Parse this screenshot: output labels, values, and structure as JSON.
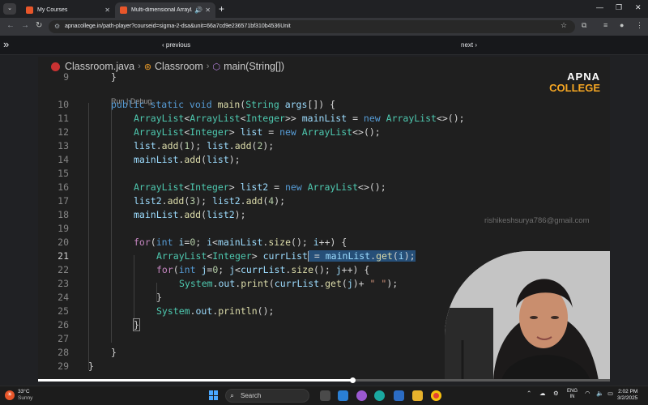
{
  "browser": {
    "tabs": [
      {
        "title": "My Courses",
        "active": false
      },
      {
        "title": "Multi-dimensional ArrayLi...",
        "active": true
      }
    ],
    "url": "apnacollege.in/path-player?courseid=sigma-2-dsa&unit=66a7cd9e236571bf310b4536Unit"
  },
  "player": {
    "prev_label": "‹ previous",
    "next_label": "next ›",
    "progress": 0.55
  },
  "editor": {
    "breadcrumb": {
      "file": "Classroom.java",
      "class": "Classroom",
      "method": "main(String[])"
    },
    "codelens": "Run | Debug",
    "current_line": 21,
    "lines": [
      {
        "n": 9,
        "text": "}"
      },
      {
        "n": 10,
        "text": "public static void main(String args[]) {"
      },
      {
        "n": 11,
        "text": "ArrayList<ArrayList<Integer>> mainList = new ArrayList<>();"
      },
      {
        "n": 12,
        "text": "ArrayList<Integer> list = new ArrayList<>();"
      },
      {
        "n": 13,
        "text": "list.add(1); list.add(2);"
      },
      {
        "n": 14,
        "text": "mainList.add(list);"
      },
      {
        "n": 15,
        "text": ""
      },
      {
        "n": 16,
        "text": "ArrayList<Integer> list2 = new ArrayList<>();"
      },
      {
        "n": 17,
        "text": "list2.add(3); list2.add(4);"
      },
      {
        "n": 18,
        "text": "mainList.add(list2);"
      },
      {
        "n": 19,
        "text": ""
      },
      {
        "n": 20,
        "text": "for(int i=0; i<mainList.size(); i++) {"
      },
      {
        "n": 21,
        "text": "ArrayList<Integer> currList = mainList.get(i);"
      },
      {
        "n": 22,
        "text": "for(int j=0; j<currList.size(); j++) {"
      },
      {
        "n": 23,
        "text": "System.out.print(currList.get(j)+ \" \");"
      },
      {
        "n": 24,
        "text": "}"
      },
      {
        "n": 25,
        "text": "System.out.println();"
      },
      {
        "n": 26,
        "text": "}"
      },
      {
        "n": 27,
        "text": ""
      },
      {
        "n": 28,
        "text": "}"
      },
      {
        "n": 29,
        "text": "}"
      }
    ]
  },
  "overlay": {
    "logo_top": "APNA",
    "logo_bottom": "COLLEGE",
    "watermark": "rishikeshsurya786@gmail.com"
  },
  "taskbar": {
    "weather_temp": "33°C",
    "weather_desc": "Sunny",
    "search_placeholder": "Search",
    "lang_top": "ENG",
    "lang_bottom": "IN",
    "time": "2:02 PM",
    "date": "3/2/2025"
  }
}
